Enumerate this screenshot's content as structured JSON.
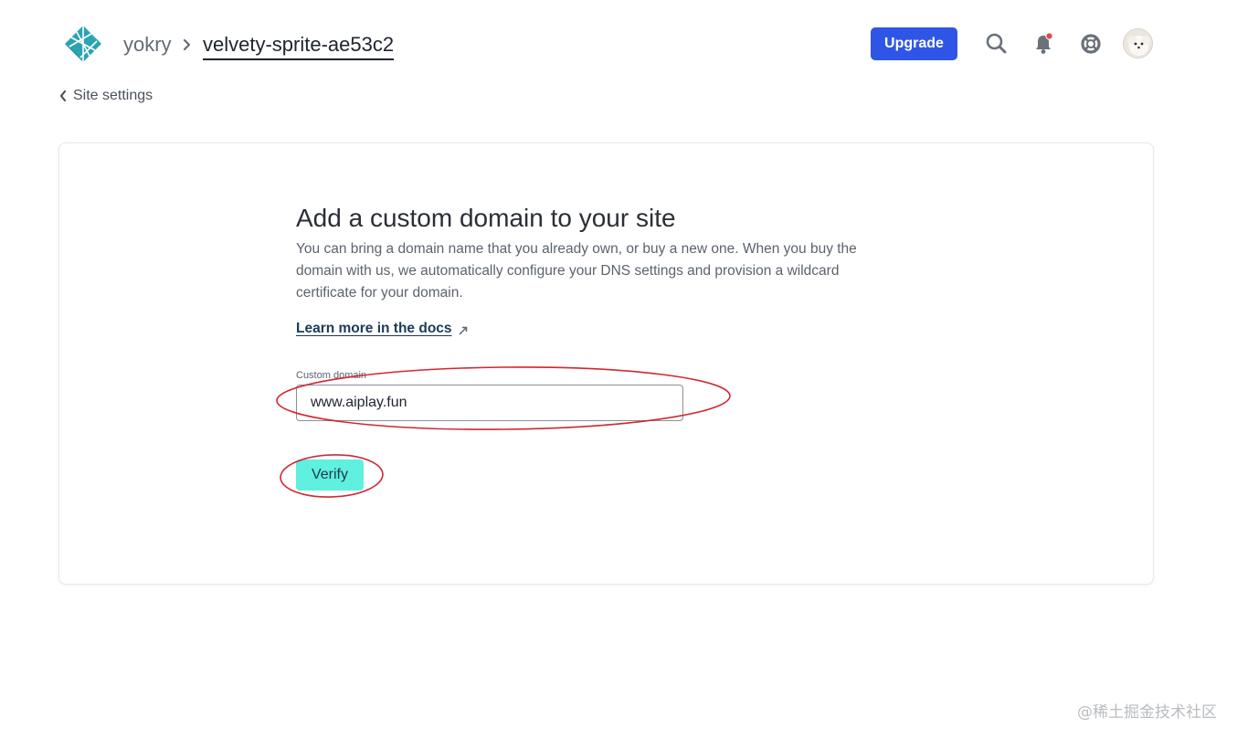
{
  "header": {
    "team_name": "yokry",
    "site_name": "velvety-sprite-ae53c2",
    "upgrade_label": "Upgrade",
    "icons": [
      "netlify-logo",
      "search-icon",
      "notification-bell-icon",
      "help-lifebuoy-icon",
      "user-avatar"
    ],
    "notification_badge_color": "#e5484d"
  },
  "nav": {
    "back_label": "Site settings"
  },
  "form": {
    "title": "Add a custom domain to your site",
    "description": "You can bring a domain name that you already own, or buy a new one. When you buy the domain with us, we automatically configure your DNS settings and provision a wildcard certificate for your domain.",
    "docs_link_label": "Learn more in the docs",
    "custom_domain_label": "Custom domain",
    "custom_domain_value": "www.aiplay.fun",
    "verify_label": "Verify"
  },
  "colors": {
    "upgrade_button": "#2f55e6",
    "verify_button": "#5ff0e0",
    "annotation": "#d22630"
  },
  "watermark": "@稀土掘金技术社区"
}
